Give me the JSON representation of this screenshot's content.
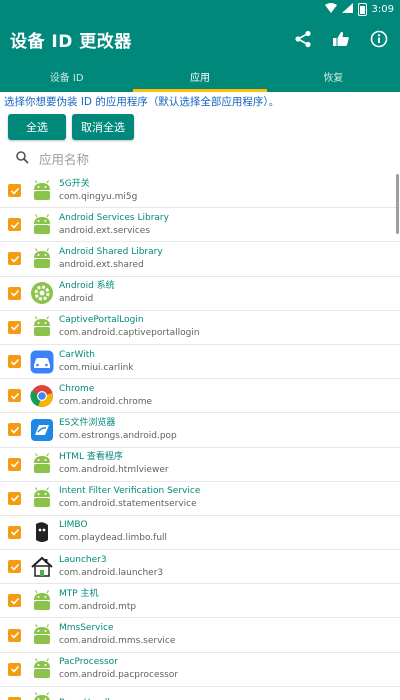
{
  "status_bar": {
    "time": "3:09"
  },
  "app_bar": {
    "title": "设备 ID 更改器"
  },
  "tabs": [
    {
      "label": "设备 ID",
      "active": false
    },
    {
      "label": "应用",
      "active": true
    },
    {
      "label": "恢复",
      "active": false
    }
  ],
  "hint": "选择你想要伪装 ID 的应用程序（默认选择全部应用程序）。",
  "buttons": {
    "select_all": "全选",
    "deselect_all": "取消全选"
  },
  "search": {
    "placeholder": "应用名称"
  },
  "colors": {
    "accent": "#00897b",
    "tab_indicator": "#ffc107",
    "checkbox": "#f39c12",
    "hint": "#1565c0"
  },
  "apps": [
    {
      "name": "5G开关",
      "package": "com.qingyu.mi5g",
      "icon": "android-icon",
      "checked": true
    },
    {
      "name": "Android Services Library",
      "package": "android.ext.services",
      "icon": "android-icon",
      "checked": true
    },
    {
      "name": "Android Shared Library",
      "package": "android.ext.shared",
      "icon": "android-icon",
      "checked": true
    },
    {
      "name": "Android 系统",
      "package": "android",
      "icon": "settings-gear-icon",
      "checked": true
    },
    {
      "name": "CaptivePortalLogin",
      "package": "com.android.captiveportallogin",
      "icon": "android-icon",
      "checked": true
    },
    {
      "name": "CarWith",
      "package": "com.miui.carlink",
      "icon": "car-icon",
      "checked": true
    },
    {
      "name": "Chrome",
      "package": "com.android.chrome",
      "icon": "chrome-icon",
      "checked": true
    },
    {
      "name": "ES文件浏览器",
      "package": "com.estrongs.android.pop",
      "icon": "es-file-icon",
      "checked": true
    },
    {
      "name": "HTML 查看程序",
      "package": "com.android.htmlviewer",
      "icon": "android-icon",
      "checked": true
    },
    {
      "name": "Intent Filter Verification Service",
      "package": "com.android.statementservice",
      "icon": "android-icon",
      "checked": true
    },
    {
      "name": "LIMBO",
      "package": "com.playdead.limbo.full",
      "icon": "limbo-icon",
      "checked": true
    },
    {
      "name": "Launcher3",
      "package": "com.android.launcher3",
      "icon": "house-icon",
      "checked": true
    },
    {
      "name": "MTP 主机",
      "package": "com.android.mtp",
      "icon": "android-icon",
      "checked": true
    },
    {
      "name": "MmsService",
      "package": "com.android.mms.service",
      "icon": "android-icon",
      "checked": true
    },
    {
      "name": "PacProcessor",
      "package": "com.android.pacprocessor",
      "icon": "android-icon",
      "checked": true
    },
    {
      "name": "ProxyHandler",
      "package": "",
      "icon": "android-icon",
      "checked": true
    }
  ]
}
